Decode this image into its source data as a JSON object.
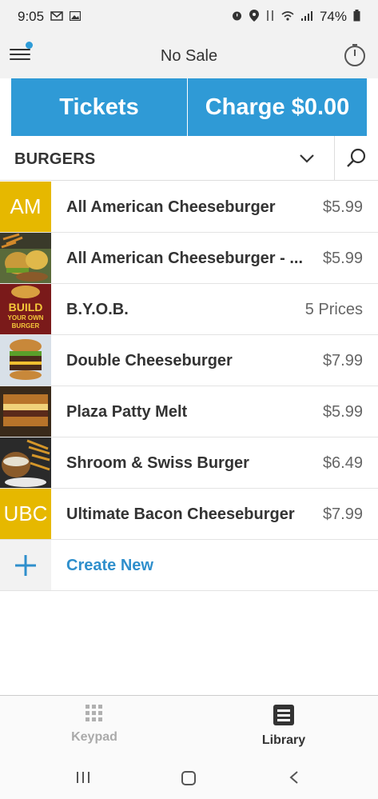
{
  "status_bar": {
    "time": "9:05",
    "battery": "74%",
    "left_icons": [
      "mail-icon",
      "image-icon"
    ],
    "right_icons": [
      "alarm-icon",
      "location-icon",
      "data-icon",
      "wifi-icon",
      "signal-icon",
      "battery-icon"
    ]
  },
  "header": {
    "title": "No Sale"
  },
  "actions": {
    "tickets_label": "Tickets",
    "charge_label": "Charge $0.00"
  },
  "category": {
    "selected": "BURGERS"
  },
  "items": [
    {
      "name": "All American Cheeseburger",
      "price": "$5.99",
      "abbr": "AM"
    },
    {
      "name": "All American Cheeseburger - ...",
      "price": "$5.99",
      "abbr": ""
    },
    {
      "name": "B.Y.O.B.",
      "price": "5 Prices",
      "abbr": ""
    },
    {
      "name": "Double Cheeseburger",
      "price": "$7.99",
      "abbr": ""
    },
    {
      "name": "Plaza Patty Melt",
      "price": "$5.99",
      "abbr": ""
    },
    {
      "name": "Shroom & Swiss Burger",
      "price": "$6.49",
      "abbr": ""
    },
    {
      "name": "Ultimate Bacon Cheeseburger",
      "price": "$7.99",
      "abbr": "UBC"
    }
  ],
  "create_new_label": "Create New",
  "byob_image_text": "BUILD YOUR OWN BURGER",
  "bottom_nav": {
    "keypad_label": "Keypad",
    "library_label": "Library"
  },
  "colors": {
    "accent": "#2f9ad6",
    "abbr_tile": "#e6b800",
    "link": "#2f8fcc"
  }
}
